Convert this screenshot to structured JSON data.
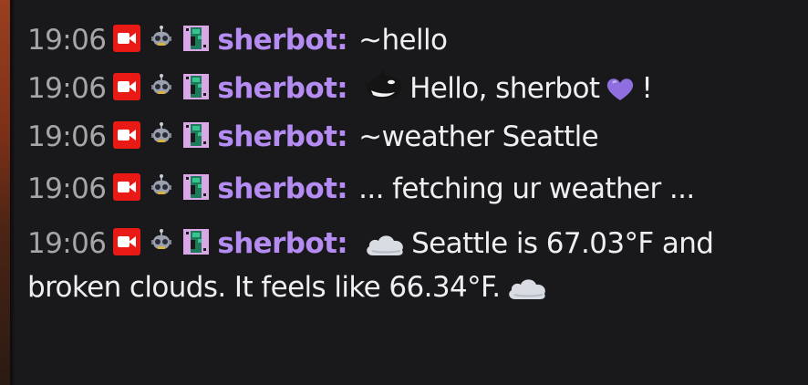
{
  "chat": {
    "messages": [
      {
        "timestamp": "19:06",
        "username": "sherbot:",
        "badges": [
          "broadcaster-icon",
          "bot-icon",
          "subscriber-icon"
        ],
        "parts": [
          "~hello"
        ]
      },
      {
        "timestamp": "19:06",
        "username": "sherbot:",
        "badges": [
          "broadcaster-icon",
          "bot-icon",
          "subscriber-icon"
        ],
        "parts": [
          "Hello, sherbot",
          "!"
        ],
        "emotes": [
          "orca-emote",
          "purple-heart-emote"
        ]
      },
      {
        "timestamp": "19:06",
        "username": "sherbot:",
        "badges": [
          "broadcaster-icon",
          "bot-icon",
          "subscriber-icon"
        ],
        "parts": [
          "~weather Seattle"
        ]
      },
      {
        "timestamp": "19:06",
        "username": "sherbot:",
        "badges": [
          "broadcaster-icon",
          "bot-icon",
          "subscriber-icon"
        ],
        "parts": [
          "... fetching ur weather ..."
        ]
      },
      {
        "timestamp": "19:06",
        "username": "sherbot:",
        "badges": [
          "broadcaster-icon",
          "bot-icon",
          "subscriber-icon"
        ],
        "parts": [
          "Seattle is 67.03°F and broken clouds. It feels like 66.34°F."
        ],
        "emotes": [
          "cloud-emote",
          "cloud-emote"
        ]
      }
    ]
  },
  "colors": {
    "background": "#19181b",
    "text": "#efeff1",
    "timestamp": "#a8a5a8",
    "username": "#b48cf2",
    "broadcaster_badge": "#e91916"
  }
}
